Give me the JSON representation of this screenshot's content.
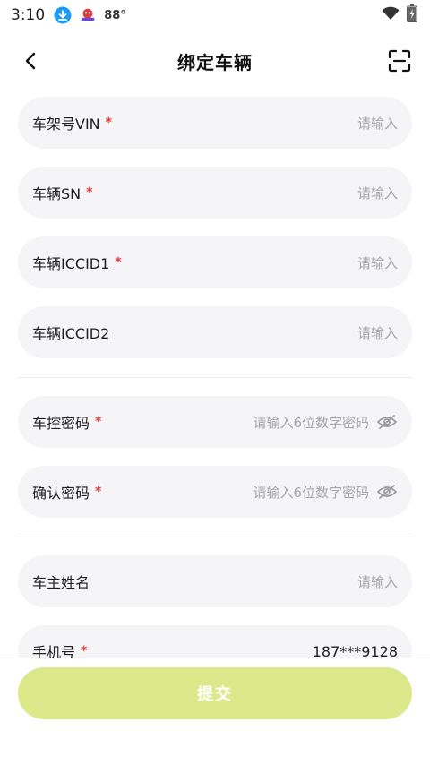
{
  "status_bar": {
    "time": "3:10",
    "temperature": "88°",
    "icons": [
      "download-icon",
      "app-notification-icon",
      "wifi-icon",
      "battery-charging-icon"
    ]
  },
  "header": {
    "title": "绑定车辆",
    "back_icon": "back-chevron-icon",
    "scan_icon": "scan-icon"
  },
  "form": {
    "fields": [
      {
        "label": "车架号VIN",
        "required": "*",
        "value": "请输入"
      },
      {
        "label": "车辆SN",
        "required": "*",
        "value": "请输入"
      },
      {
        "label": "车辆ICCID1",
        "required": "*",
        "value": "请输入"
      },
      {
        "label": "车辆ICCID2",
        "required": "",
        "value": "请输入"
      },
      {
        "label": "车控密码",
        "required": "*",
        "value": "请输入6位数字密码"
      },
      {
        "label": "确认密码",
        "required": "*",
        "value": "请输入6位数字密码"
      },
      {
        "label": "车主姓名",
        "required": "",
        "value": "请输入"
      },
      {
        "label": "手机号",
        "required": "*",
        "value": "187***9128"
      }
    ]
  },
  "submit": {
    "label": "提交"
  },
  "colors": {
    "accent": "#dbe98a",
    "required": "#e53935",
    "field_bg": "#f5f5f7",
    "placeholder": "#a6a6a6"
  }
}
